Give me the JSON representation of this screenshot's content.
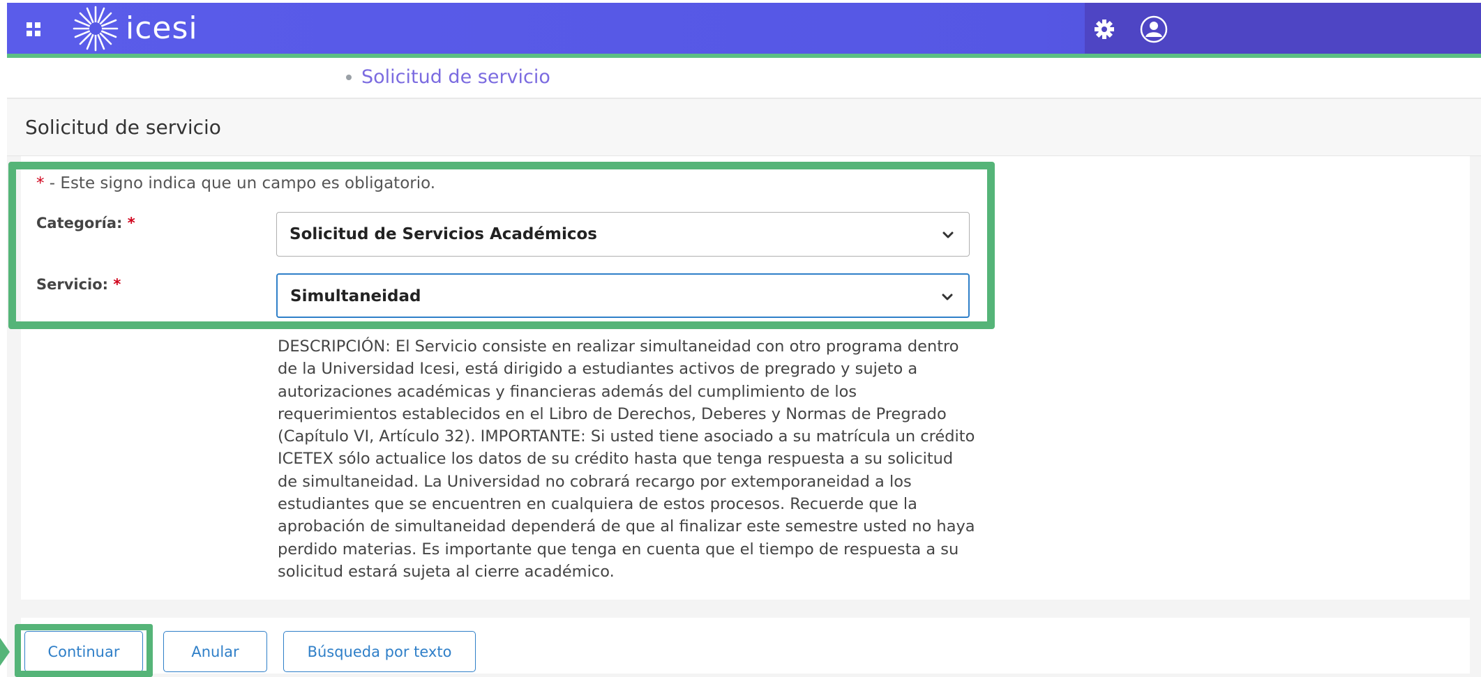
{
  "header": {
    "logo_text": "icesi",
    "brand_color": "#5a5cea",
    "accent_line_color": "#5cbf83",
    "icons": [
      "grid-menu-icon",
      "icesi-sun-logo-icon",
      "gear-icon",
      "user-icon"
    ]
  },
  "breadcrumb": {
    "item": "Solicitud de servicio"
  },
  "page": {
    "title": "Solicitud de servicio"
  },
  "form": {
    "required_note_star": "*",
    "required_note_text": " - Este signo indica que un campo es obligatorio.",
    "categoria": {
      "label": "Categoría:",
      "required_star": "*",
      "value": "Solicitud de Servicios Académicos"
    },
    "servicio": {
      "label": "Servicio:",
      "required_star": "*",
      "value": "Simultaneidad"
    },
    "description": "DESCRIPCIÓN: El Servicio consiste en realizar simultaneidad con otro programa dentro de la Universidad Icesi, está dirigido a estudiantes activos de pregrado y sujeto a autorizaciones académicas y financieras además del cumplimiento de los requerimientos establecidos en el Libro de Derechos, Deberes y Normas de Pregrado (Capítulo VI, Artículo 32). IMPORTANTE: Si usted tiene asociado a su matrícula un crédito ICETEX sólo actualice los datos de su crédito hasta que tenga respuesta a su solicitud de simultaneidad. La Universidad no cobrará recargo por extemporaneidad a los estudiantes que se encuentren en cualquiera de estos procesos. Recuerde que la aprobación de simultaneidad dependerá de que al finalizar este semestre usted no haya perdido materias. Es importante que tenga en cuenta que el tiempo de respuesta a su solicitud estará sujeta al cierre académico."
  },
  "actions": {
    "continue_label": "Continuar",
    "cancel_label": "Anular",
    "search_label": "Búsqueda por texto",
    "button_color": "#2f7fc8"
  },
  "annotations": {
    "highlight_color": "#55b478"
  }
}
